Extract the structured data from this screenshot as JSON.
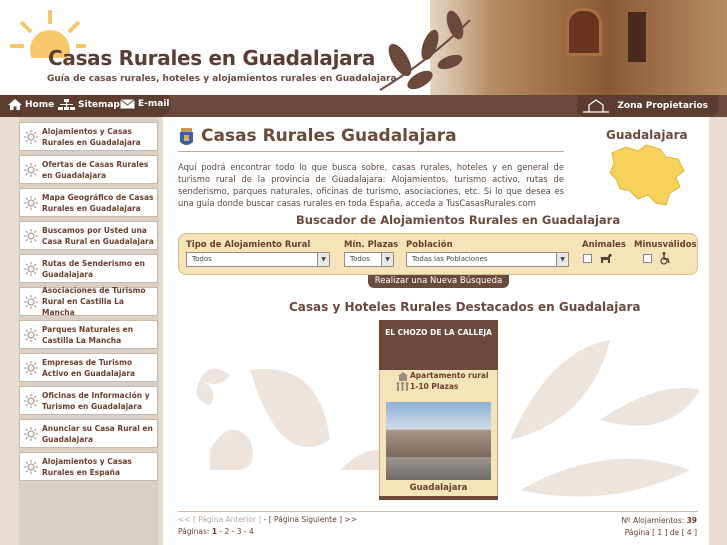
{
  "header": {
    "site_title": "Casas Rurales en Guadalajara",
    "site_subtitle": "Guía de casas rurales, hoteles y alojamientos rurales en Guadalajara"
  },
  "nav": {
    "home": "Home",
    "sitemap": "Sitemap",
    "email": "E-mail",
    "zona": "Zona Propietarios"
  },
  "sidebar": {
    "items": [
      {
        "label": "Alojamientos y Casas Rurales en Guadalajara"
      },
      {
        "label": "Ofertas de Casas Rurales en Guadalajara"
      },
      {
        "label": "Mapa Geográfico de Casas Rurales en Guadalajara"
      },
      {
        "label": "Buscamos por Usted una Casa Rural en Guadalajara"
      },
      {
        "label": "Rutas de Senderismo en Guadalajara"
      },
      {
        "label": "Asociaciones de Turismo Rural en Castilla La Mancha"
      },
      {
        "label": "Parques Naturales en Castilla La Mancha"
      },
      {
        "label": "Empresas de Turismo Activo en Guadalajara"
      },
      {
        "label": "Oficinas de Información y Turismo en Guadalajara"
      },
      {
        "label": "Anunciar su Casa Rural en Guadalajara"
      },
      {
        "label": "Alojamientos y Casas Rurales en España"
      }
    ]
  },
  "main": {
    "title": "Casas Rurales Guadalajara",
    "intro": "Aquí podrá encontrar todo lo que busca sobre, casas rurales, hoteles y en general de turismo rural de la provincia de Guadalajara: Alojamientos, turismo activo, rutas de senderismo, parques naturales, oficinas de turismo, asociaciones, etc. Si lo que desea es una guía donde buscar casas rurales en toda España, acceda a TusCasasRurales.com",
    "map_label": "Guadalajara"
  },
  "search": {
    "title": "Buscador de Alojamientos Rurales en Guadalajara",
    "type_label": "Tipo de Alojamiento Rural",
    "type_value": "Todos",
    "plazas_label": "Mín. Plazas",
    "plazas_value": "Todos",
    "poblacion_label": "Población",
    "poblacion_value": "Todas las Poblaciones",
    "animales_label": "Animales",
    "minusvalidos_label": "Minusválidos",
    "button": "Realizar una Nueva Búsqueda"
  },
  "featured": {
    "title": "Casas y Hoteles Rurales Destacados en Guadalajara",
    "card": {
      "name": "EL CHOZO DE LA CALLEJA",
      "type": "Apartamento rural",
      "plazas": "1-10 Plazas",
      "place": "Guadalajara"
    }
  },
  "pager": {
    "prev": "<< [ Página Anterior ]",
    "sep": " - ",
    "next": "[ Página Siguiente ] >>",
    "pages_label": "Páginas:",
    "current": "1",
    "others": "- 2 - 3 - 4",
    "count_label": "Nº Alojamientos:",
    "count": "39",
    "page_of": "Página [ 1 ] de [ 4 ]"
  },
  "colors": {
    "brand_brown": "#6b4a3e",
    "accent_sand": "#f5e4b8",
    "sun": "#f6c86a"
  }
}
